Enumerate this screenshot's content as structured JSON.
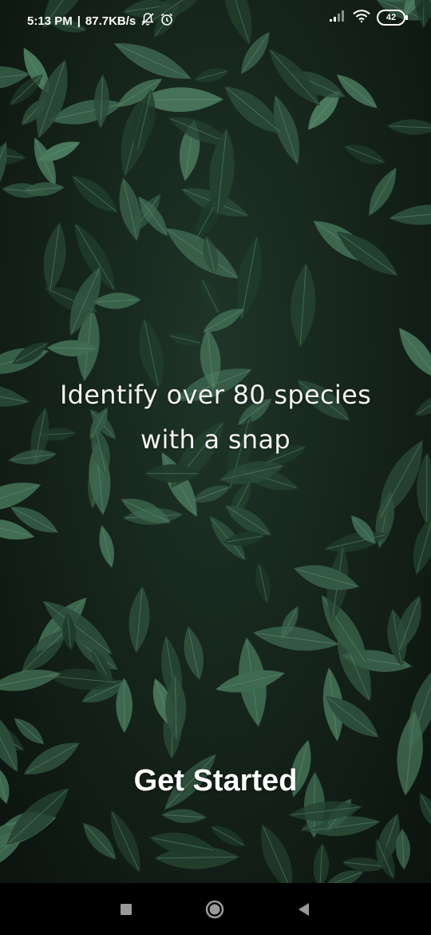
{
  "status_bar": {
    "time": "5:13 PM",
    "separator": "|",
    "net_speed": "87.7KB/s",
    "battery": "42",
    "icons": [
      "notifications-muted-icon",
      "alarm-icon",
      "signal-icon",
      "wifi-icon",
      "battery-icon"
    ]
  },
  "main": {
    "headline_line1": "Identify over 80 species",
    "headline_line2": "with a snap",
    "cta_label": "Get Started"
  },
  "nav_bar": {
    "icons": [
      "recent-apps-icon",
      "home-icon",
      "back-icon"
    ]
  },
  "colors": {
    "leaf_dark": "#1f3a2a",
    "leaf_light": "#3f6b52",
    "text": "#ffffff",
    "nav_bg": "#000000"
  }
}
